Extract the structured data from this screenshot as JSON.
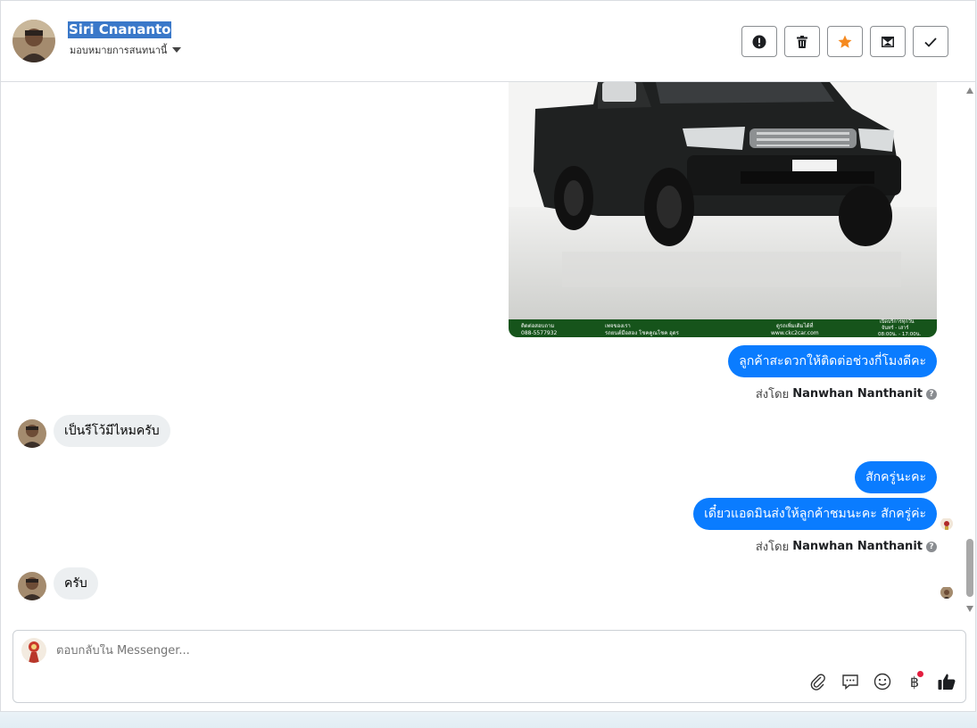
{
  "header": {
    "contact_name": "Siri Cnananto",
    "assign_label": "มอบหมายการสนทนานี้"
  },
  "actions": [
    {
      "name": "spam",
      "icon": "alert-circle-icon"
    },
    {
      "name": "delete",
      "icon": "trash-icon"
    },
    {
      "name": "star",
      "icon": "star-icon",
      "color": "#f5891f"
    },
    {
      "name": "mark-unread",
      "icon": "envelope-icon"
    },
    {
      "name": "done",
      "icon": "check-icon"
    }
  ],
  "car_image": {
    "banner_left": "ติดต่อสอบถาม",
    "banner_phone": "088-5577932",
    "banner_page": "เพจของเรา",
    "banner_page_name": "รถยนต์มือสอง โชคคูณโชค อุดร",
    "banner_site_title": "ดูรถเพิ่มเติมได้ที่",
    "banner_site": "www.ckc2car.com",
    "banner_hours_title": "เปิดบริการทุกวัน",
    "banner_days": "จันทร์ - เสาร์",
    "banner_time": "08:00น. - 17:00น."
  },
  "messages": {
    "m1": "ลูกค้าสะดวกให้ติดต่อช่วงกี่โมงดีคะ",
    "sent_by_label": "ส่งโดย",
    "sent_by_name": "Nanwhan Nanthanit",
    "m2": "เป็นรีโว้มีไหมครับ",
    "m3": "สักครู่นะคะ",
    "m4": "เดี๋ยวแอดมินส่งให้ลูกค้าชมนะคะ สักครู่ค่ะ",
    "m5": "ครับ"
  },
  "composer": {
    "placeholder": "ตอบกลับใน Messenger..."
  },
  "colors": {
    "outgoing_bubble": "#0a7cff",
    "incoming_bubble": "#eceff1",
    "accent": "#3a78c9"
  }
}
